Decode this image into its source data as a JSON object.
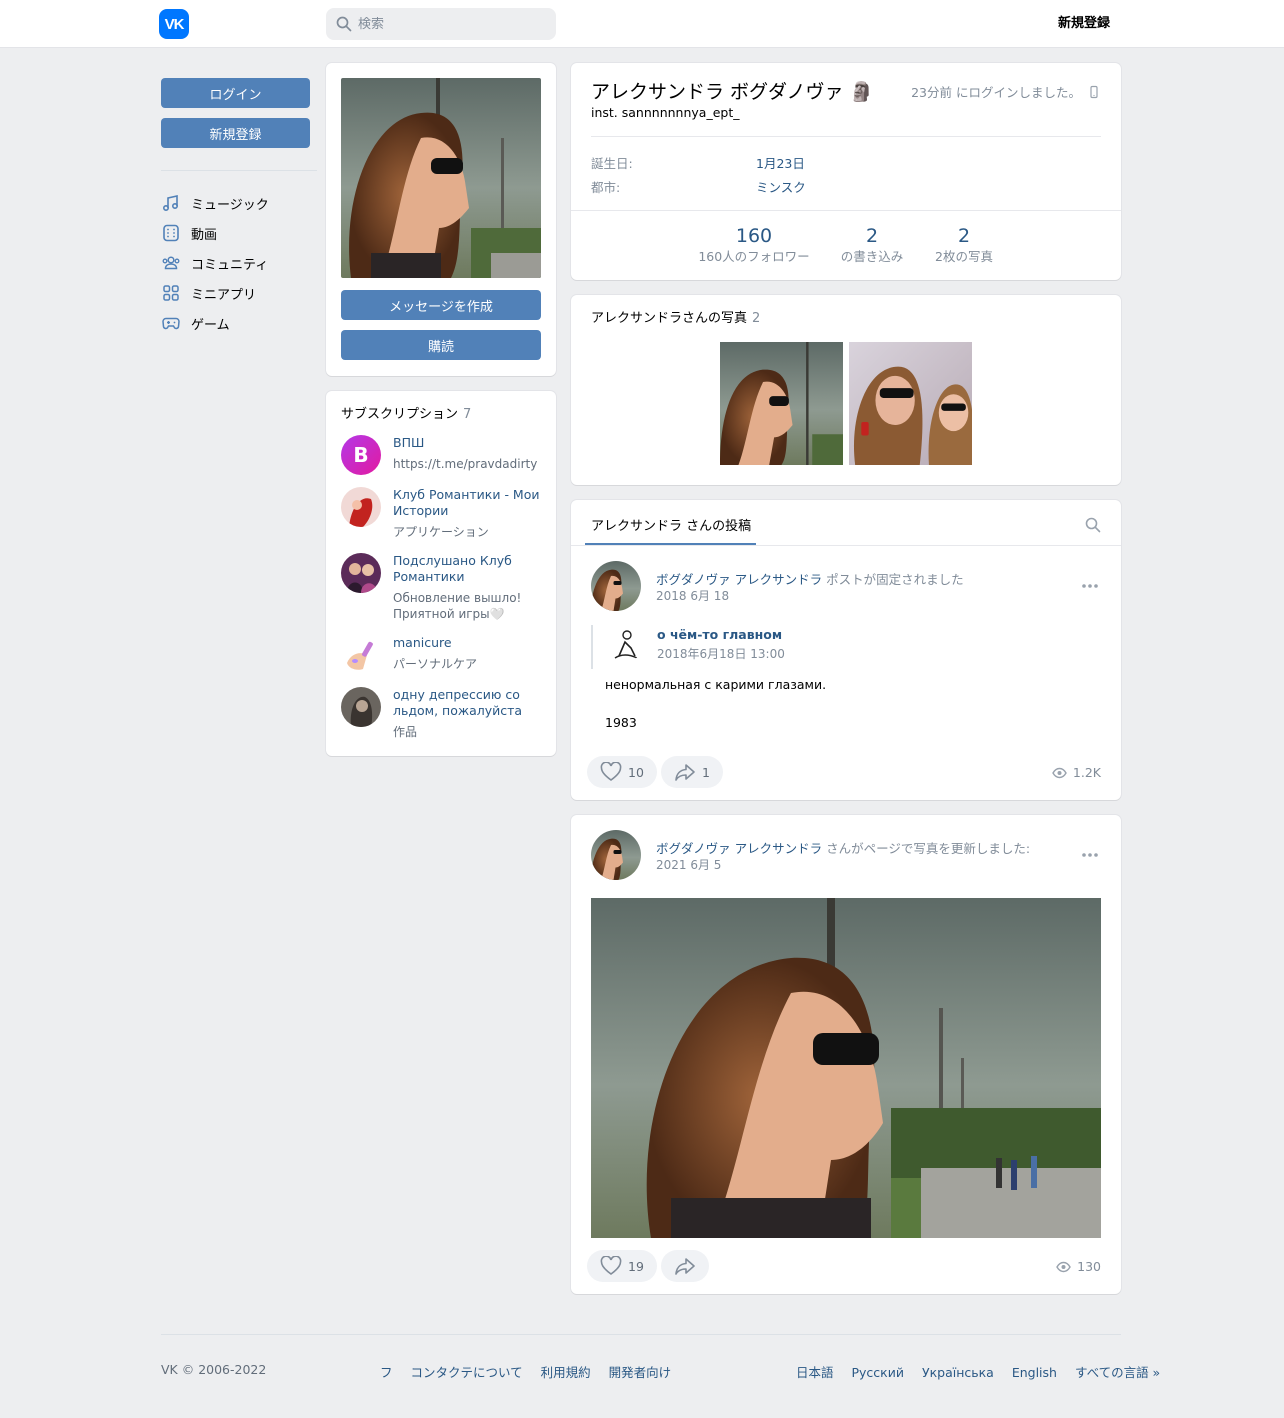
{
  "header": {
    "logo": "VK",
    "search_placeholder": "検索",
    "signup": "新規登録"
  },
  "left": {
    "login": "ログイン",
    "signup": "新規登録",
    "menu": [
      {
        "label": "ミュージック",
        "icon": "music-icon"
      },
      {
        "label": "動画",
        "icon": "video-icon"
      },
      {
        "label": "コミュニティ",
        "icon": "community-icon"
      },
      {
        "label": "ミニアプリ",
        "icon": "mini-apps-icon"
      },
      {
        "label": "ゲーム",
        "icon": "gamepad-icon"
      }
    ]
  },
  "avatar_card": {
    "message": "メッセージを作成",
    "subscribe": "購読"
  },
  "subscriptions": {
    "title": "サブスクリプション",
    "count": "7",
    "items": [
      {
        "name": "ВПШ",
        "desc": "https://t.me/pravdadirty"
      },
      {
        "name": "Клуб Романтики - Мои Истории",
        "desc": "アプリケーション"
      },
      {
        "name": "Подслушано Клуб Романтики",
        "desc": "Обновление вышло! Приятной игры🤍"
      },
      {
        "name": "manicure",
        "desc": "パーソナルケア"
      },
      {
        "name": "одну депрессию со льдом, пожалуйста",
        "desc": "作品"
      }
    ]
  },
  "profile": {
    "name": "アレクサンドラ ボグダノヴァ 🗿",
    "status": "inst. sannnnnnnya_ept_",
    "last_seen": "23分前 にログインしました。",
    "birthday_label": "誕生日:",
    "birthday": "1月23日",
    "city_label": "都市:",
    "city": "ミンスク",
    "counters": [
      {
        "num": "160",
        "label": "160人のフォロワー"
      },
      {
        "num": "2",
        "label": "の書き込み"
      },
      {
        "num": "2",
        "label": "2枚の写真"
      }
    ]
  },
  "photos": {
    "title": "アレクサンドラさんの写真",
    "count": "2"
  },
  "wall": {
    "tab": "アレクサンドラ さんの投稿",
    "post1": {
      "author": "ボグダノヴァ アレクサンドラ",
      "action": " ポストが固定されました",
      "date": "2018 6月 18",
      "repost_name": "о чём-то главном",
      "repost_date": "2018年6月18日 13:00",
      "text1": "ненормальная с карими глазами.",
      "text2": "1983",
      "likes": "10",
      "shares": "1",
      "views": "1.2K"
    },
    "post2": {
      "author": "ボグダノヴァ アレクサンドラ",
      "action": " さんがページで写真を更新しました:",
      "date": "2021 6月 5",
      "likes": "19",
      "views": "130"
    }
  },
  "footer": {
    "copyright": "VK © 2006-2022",
    "links": [
      "フ",
      "コンタクテについて",
      "利用規約",
      "開発者向け"
    ],
    "langs": [
      "日本語",
      "Русский",
      "Українська",
      "English",
      "すべての言語 »"
    ]
  },
  "colors": {
    "accent": "#5181b8",
    "link": "#2a5885",
    "brand": "#0077ff",
    "background": "#edeef0"
  }
}
